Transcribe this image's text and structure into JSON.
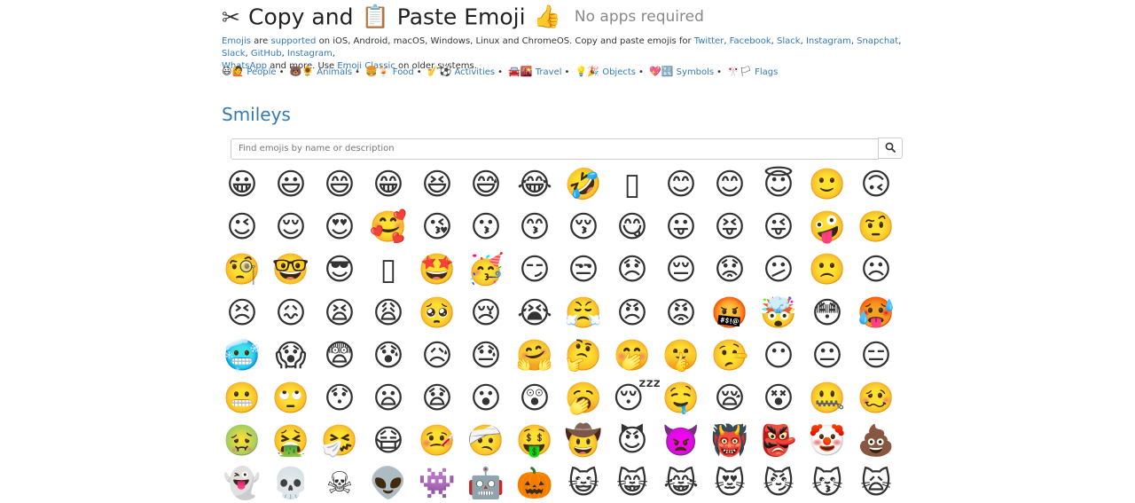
{
  "header": {
    "title_part1": "Copy and",
    "title_part2": "Paste Emoji",
    "icon_scissors": "✂",
    "icon_clipboard": "📋",
    "icon_thumb": "👍",
    "subtitle": "No apps required"
  },
  "intro": {
    "emojis_link": "Emojis",
    "t1": " are ",
    "supported_link": "supported",
    "t2": " on iOS, Android, macOS, Windows, Linux and ChromeOS. Copy and paste emojis for ",
    "links": [
      "Twitter",
      "Facebook",
      "Slack",
      "Instagram",
      "Snapchat",
      "Slack",
      "GitHub",
      "Instagram",
      "WhatsApp"
    ],
    "t3": " and more. Use ",
    "classic_link": "Emoji Classic",
    "t4": " on older systems."
  },
  "categories": [
    {
      "emoji": "😃🙋",
      "label": "People"
    },
    {
      "emoji": "🐻🌻",
      "label": "Animals"
    },
    {
      "emoji": "🍔🍹",
      "label": "Food"
    },
    {
      "emoji": "🎷⚽",
      "label": "Activities"
    },
    {
      "emoji": "🚘🌇",
      "label": "Travel"
    },
    {
      "emoji": "💡🎉",
      "label": "Objects"
    },
    {
      "emoji": "💖🔣",
      "label": "Symbols"
    },
    {
      "emoji": "🎌🏳",
      "label": "Flags"
    }
  ],
  "section_title": "Smileys",
  "search": {
    "placeholder": "Find emojis by name or description",
    "button_icon": "search-icon"
  },
  "emojis": [
    "😀",
    "😃",
    "😄",
    "😁",
    "😆",
    "😅",
    "😂",
    "🤣",
    "▯",
    "😊",
    "😊",
    "😇",
    "🙂",
    "🙃",
    "😉",
    "😌",
    "😍",
    "🥰",
    "😘",
    "😗",
    "😙",
    "😚",
    "😋",
    "😛",
    "😝",
    "😜",
    "🤪",
    "🤨",
    "🧐",
    "🤓",
    "😎",
    "▯",
    "🤩",
    "🥳",
    "😏",
    "😒",
    "😞",
    "😔",
    "😟",
    "😕",
    "🙁",
    "☹",
    "😣",
    "😖",
    "😫",
    "😩",
    "🥺",
    "😢",
    "😭",
    "😤",
    "😠",
    "😡",
    "🤬",
    "🤯",
    "😳",
    "🥵",
    "🥶",
    "😱",
    "😨",
    "😰",
    "😥",
    "😓",
    "🤗",
    "🤔",
    "🤭",
    "🤫",
    "🤥",
    "😶",
    "😐",
    "😑",
    "😬",
    "🙄",
    "😯",
    "😦",
    "😧",
    "😮",
    "😲",
    "🥱",
    "😴",
    "🤤",
    "😪",
    "😵",
    "🤐",
    "🥴",
    "🤢",
    "🤮",
    "🤧",
    "😷",
    "🤒",
    "🤕",
    "🤑",
    "🤠",
    "😈",
    "👿",
    "👹",
    "👺",
    "🤡",
    "💩",
    "👻",
    "💀",
    "☠",
    "👽",
    "👾",
    "🤖",
    "🎃",
    "😺",
    "😸",
    "😹",
    "😻",
    "😼",
    "😽",
    "🙀"
  ]
}
